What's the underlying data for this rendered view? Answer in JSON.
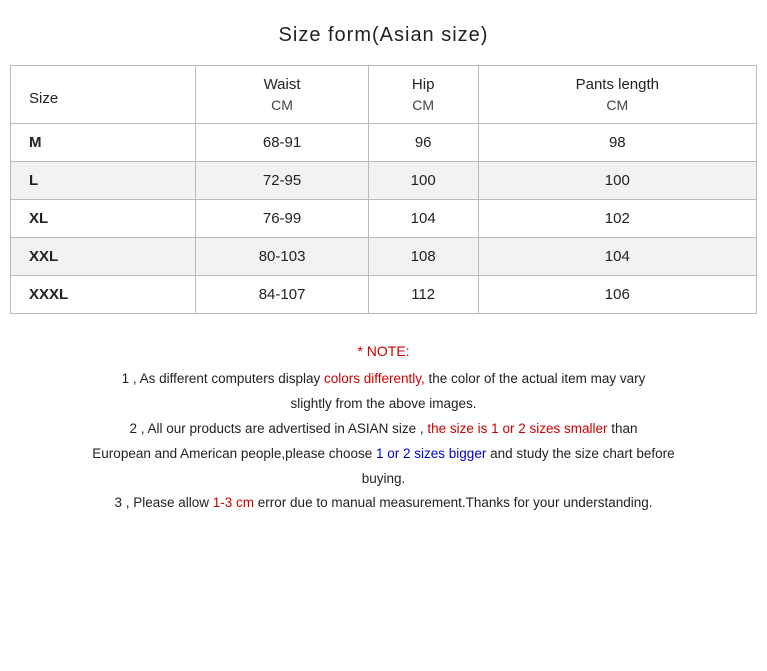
{
  "title": "Size form(Asian size)",
  "table": {
    "headers": {
      "col1": "Size",
      "col2": "Waist",
      "col3": "Hip",
      "col4": "Pants length"
    },
    "subheaders": {
      "col2": "CM",
      "col3": "CM",
      "col4": "CM"
    },
    "rows": [
      {
        "size": "M",
        "waist": "68-91",
        "hip": "96",
        "pants": "98"
      },
      {
        "size": "L",
        "waist": "72-95",
        "hip": "100",
        "pants": "100"
      },
      {
        "size": "XL",
        "waist": "76-99",
        "hip": "104",
        "pants": "102"
      },
      {
        "size": "XXL",
        "waist": "80-103",
        "hip": "108",
        "pants": "104"
      },
      {
        "size": "XXXL",
        "waist": "84-107",
        "hip": "112",
        "pants": "106"
      }
    ]
  },
  "notes": {
    "title": "* NOTE:",
    "line1_before": "1 , As different computers display ",
    "line1_red": "colors differently,",
    "line1_after": " the color of the actual item may vary",
    "line1_cont": "slightly from the above images.",
    "line2_before": "2 , All our products are advertised in ASIAN size , ",
    "line2_red": "the size is 1 or 2 sizes smaller",
    "line2_than": " than",
    "line2_cont1": "European and American people,please choose ",
    "line2_blue": "1 or 2 sizes bigger",
    "line2_cont2": " and study the size chart before",
    "line2_cont3": "buying.",
    "line3_before": "3 , Please allow ",
    "line3_red": "1-3 cm",
    "line3_after": " error due to manual measurement.Thanks for your understanding."
  }
}
